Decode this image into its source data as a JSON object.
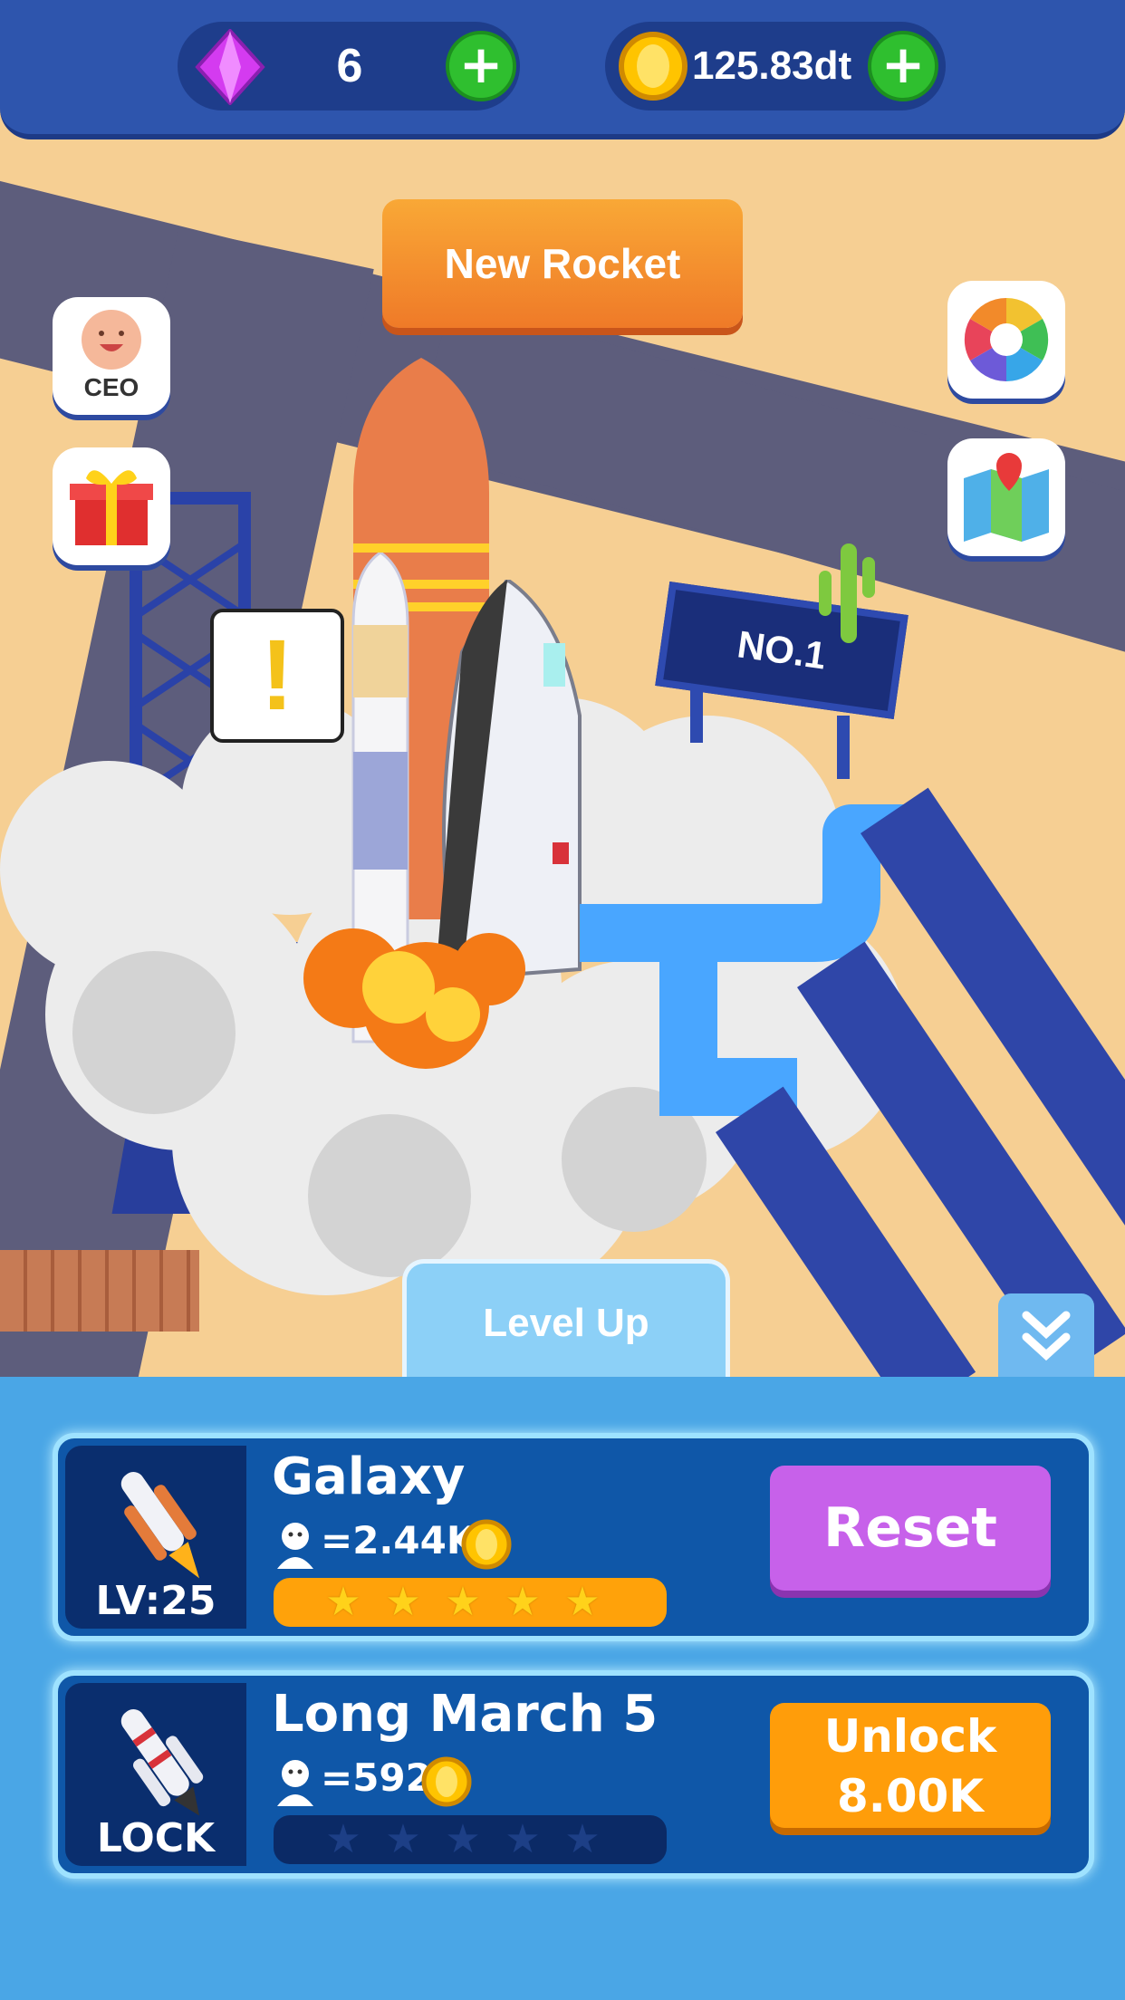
{
  "currency": {
    "gems": "6",
    "coins": "125.83dt"
  },
  "scene": {
    "new_rocket_label": "New Rocket",
    "ceo_label": "CEO",
    "launch_sign": "NO.1",
    "alert_mark": "!"
  },
  "panel": {
    "tab_label": "Level Up",
    "rockets": [
      {
        "name": "Galaxy",
        "level": "LV:25",
        "rate": "=2.44K",
        "stars_filled": 5,
        "stars_total": 5,
        "action": "Reset",
        "action_color": "#c761ea"
      },
      {
        "name": "Long March 5",
        "level": "LOCK",
        "rate": "=592",
        "stars_filled": 0,
        "stars_total": 5,
        "action_line1": "Unlock",
        "action_line2": "8.00K",
        "action_color": "#ff9d0a"
      }
    ]
  },
  "icons": [
    "gem-icon",
    "plus-icon",
    "coin-icon",
    "ceo-icon",
    "gift-icon",
    "color-wheel-icon",
    "map-icon",
    "chevron-down-icon",
    "worker-icon",
    "star-icon",
    "rocket-icon"
  ]
}
